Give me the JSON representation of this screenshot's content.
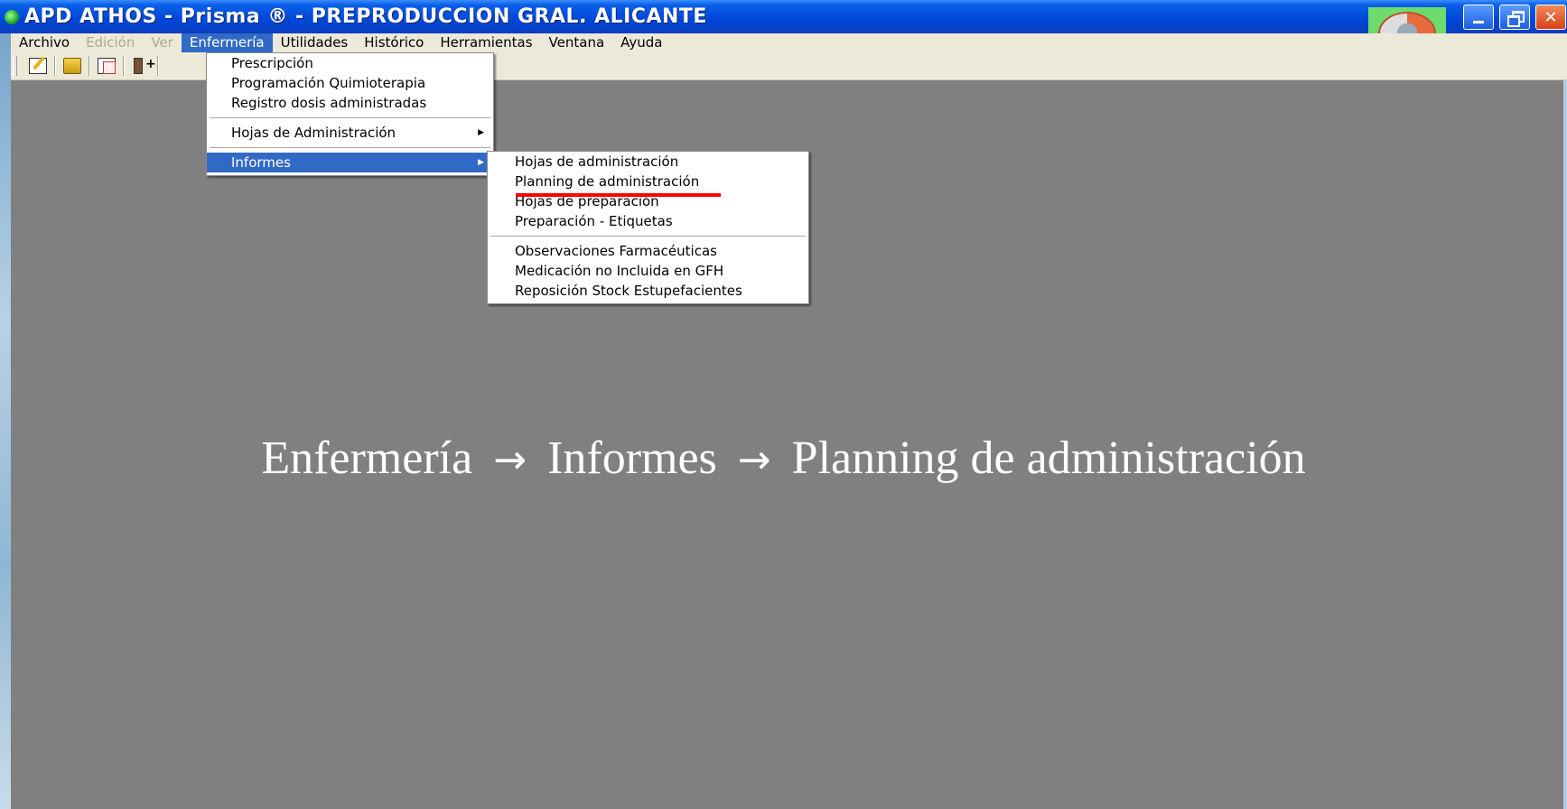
{
  "window": {
    "title": "APD ATHOS - Prisma ® - PREPRODUCCION GRAL. ALICANTE",
    "icon": "app-green-icon",
    "help_icon": "lifebuoy-icon",
    "help_highlight_color": "#6ddc6d"
  },
  "menubar": {
    "items": [
      {
        "label": "Archivo",
        "state": "enabled"
      },
      {
        "label": "Edición",
        "state": "disabled"
      },
      {
        "label": "Ver",
        "state": "disabled"
      },
      {
        "label": "Enfermería",
        "state": "active"
      },
      {
        "label": "Utilidades",
        "state": "enabled"
      },
      {
        "label": "Histórico",
        "state": "enabled"
      },
      {
        "label": "Herramientas",
        "state": "enabled"
      },
      {
        "label": "Ventana",
        "state": "enabled"
      },
      {
        "label": "Ayuda",
        "state": "enabled"
      }
    ]
  },
  "toolbar": {
    "icons": [
      "edit-icon",
      "folder-icon",
      "copy-icon",
      "exit-icon"
    ]
  },
  "enfermeria_menu": {
    "items": [
      {
        "label": "Prescripción"
      },
      {
        "label": "Programación Quimioterapia"
      },
      {
        "label": "Registro dosis administradas"
      },
      {
        "label": "Hojas de Administración",
        "submenu": true
      },
      {
        "label": "Informes",
        "submenu": true,
        "highlighted": true
      }
    ]
  },
  "informes_menu": {
    "items": [
      {
        "label": "Hojas de administración"
      },
      {
        "label": "Planning de administración",
        "marked": true
      },
      {
        "label": "Hojas de preparación"
      },
      {
        "label": "Preparación - Etiquetas"
      },
      {
        "label": "Observaciones Farmacéuticas"
      },
      {
        "label": "Medicación no Incluida en GFH"
      },
      {
        "label": "Reposición Stock Estupefacientes"
      }
    ],
    "mark_color": "#ff0000"
  },
  "caption": {
    "part1": "Enfermería",
    "part2": "Informes",
    "part3": "Planning de administración",
    "arrow": "→"
  },
  "colors": {
    "titlebar": "#0046d8",
    "menu_highlight": "#316ac5",
    "workspace": "#808080"
  }
}
